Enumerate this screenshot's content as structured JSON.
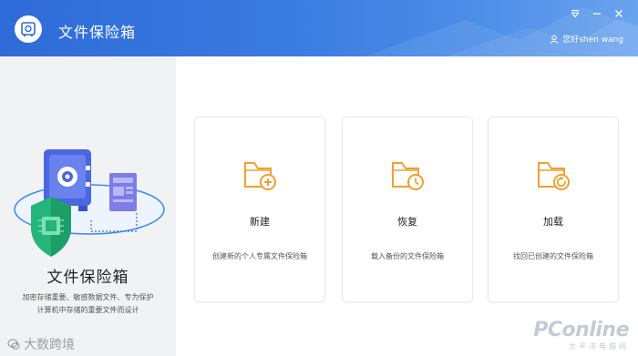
{
  "header": {
    "app_title": "文件保险箱",
    "user_greeting": "您好shen wang",
    "icons": {
      "logo": "safe-icon",
      "menu": "dropdown-menu-icon",
      "minimize": "minimize-icon",
      "close": "close-icon",
      "user": "user-icon"
    }
  },
  "left_panel": {
    "title": "文件保险箱",
    "desc_line1": "加密存储重要、敏感数据文件、专为保护",
    "desc_line2": "计算机中存储的重要文件而设计"
  },
  "cards": [
    {
      "title": "新建",
      "desc": "创建新的个人专属文件保险箱",
      "icon": "folder-add-icon"
    },
    {
      "title": "恢复",
      "desc": "载入备份的文件保险箱",
      "icon": "folder-clock-icon"
    },
    {
      "title": "加载",
      "desc": "找回已创建的文件保险箱",
      "icon": "folder-reload-icon"
    }
  ],
  "watermarks": {
    "left": "大数跨境",
    "right_main": "PConline",
    "right_sub": "太平洋电脑网"
  },
  "colors": {
    "header_blue": "#3a7be0",
    "accent_orange": "#f0a030",
    "panel_gray": "#f1f2f4"
  }
}
